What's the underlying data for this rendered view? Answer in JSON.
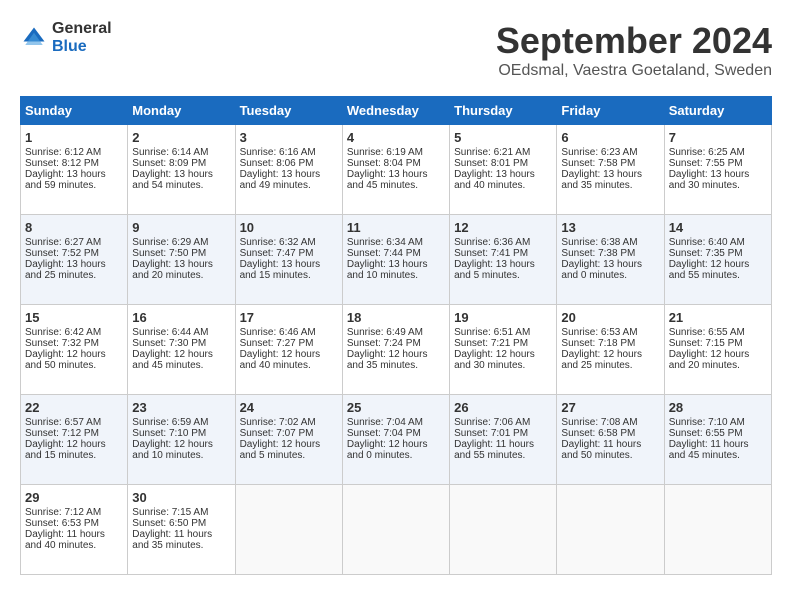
{
  "logo": {
    "general": "General",
    "blue": "Blue"
  },
  "title": "September 2024",
  "location": "OEdsmal, Vaestra Goetaland, Sweden",
  "headers": [
    "Sunday",
    "Monday",
    "Tuesday",
    "Wednesday",
    "Thursday",
    "Friday",
    "Saturday"
  ],
  "weeks": [
    [
      {
        "day": "1",
        "sunrise": "Sunrise: 6:12 AM",
        "sunset": "Sunset: 8:12 PM",
        "daylight": "Daylight: 13 hours and 59 minutes."
      },
      {
        "day": "2",
        "sunrise": "Sunrise: 6:14 AM",
        "sunset": "Sunset: 8:09 PM",
        "daylight": "Daylight: 13 hours and 54 minutes."
      },
      {
        "day": "3",
        "sunrise": "Sunrise: 6:16 AM",
        "sunset": "Sunset: 8:06 PM",
        "daylight": "Daylight: 13 hours and 49 minutes."
      },
      {
        "day": "4",
        "sunrise": "Sunrise: 6:19 AM",
        "sunset": "Sunset: 8:04 PM",
        "daylight": "Daylight: 13 hours and 45 minutes."
      },
      {
        "day": "5",
        "sunrise": "Sunrise: 6:21 AM",
        "sunset": "Sunset: 8:01 PM",
        "daylight": "Daylight: 13 hours and 40 minutes."
      },
      {
        "day": "6",
        "sunrise": "Sunrise: 6:23 AM",
        "sunset": "Sunset: 7:58 PM",
        "daylight": "Daylight: 13 hours and 35 minutes."
      },
      {
        "day": "7",
        "sunrise": "Sunrise: 6:25 AM",
        "sunset": "Sunset: 7:55 PM",
        "daylight": "Daylight: 13 hours and 30 minutes."
      }
    ],
    [
      {
        "day": "8",
        "sunrise": "Sunrise: 6:27 AM",
        "sunset": "Sunset: 7:52 PM",
        "daylight": "Daylight: 13 hours and 25 minutes."
      },
      {
        "day": "9",
        "sunrise": "Sunrise: 6:29 AM",
        "sunset": "Sunset: 7:50 PM",
        "daylight": "Daylight: 13 hours and 20 minutes."
      },
      {
        "day": "10",
        "sunrise": "Sunrise: 6:32 AM",
        "sunset": "Sunset: 7:47 PM",
        "daylight": "Daylight: 13 hours and 15 minutes."
      },
      {
        "day": "11",
        "sunrise": "Sunrise: 6:34 AM",
        "sunset": "Sunset: 7:44 PM",
        "daylight": "Daylight: 13 hours and 10 minutes."
      },
      {
        "day": "12",
        "sunrise": "Sunrise: 6:36 AM",
        "sunset": "Sunset: 7:41 PM",
        "daylight": "Daylight: 13 hours and 5 minutes."
      },
      {
        "day": "13",
        "sunrise": "Sunrise: 6:38 AM",
        "sunset": "Sunset: 7:38 PM",
        "daylight": "Daylight: 13 hours and 0 minutes."
      },
      {
        "day": "14",
        "sunrise": "Sunrise: 6:40 AM",
        "sunset": "Sunset: 7:35 PM",
        "daylight": "Daylight: 12 hours and 55 minutes."
      }
    ],
    [
      {
        "day": "15",
        "sunrise": "Sunrise: 6:42 AM",
        "sunset": "Sunset: 7:32 PM",
        "daylight": "Daylight: 12 hours and 50 minutes."
      },
      {
        "day": "16",
        "sunrise": "Sunrise: 6:44 AM",
        "sunset": "Sunset: 7:30 PM",
        "daylight": "Daylight: 12 hours and 45 minutes."
      },
      {
        "day": "17",
        "sunrise": "Sunrise: 6:46 AM",
        "sunset": "Sunset: 7:27 PM",
        "daylight": "Daylight: 12 hours and 40 minutes."
      },
      {
        "day": "18",
        "sunrise": "Sunrise: 6:49 AM",
        "sunset": "Sunset: 7:24 PM",
        "daylight": "Daylight: 12 hours and 35 minutes."
      },
      {
        "day": "19",
        "sunrise": "Sunrise: 6:51 AM",
        "sunset": "Sunset: 7:21 PM",
        "daylight": "Daylight: 12 hours and 30 minutes."
      },
      {
        "day": "20",
        "sunrise": "Sunrise: 6:53 AM",
        "sunset": "Sunset: 7:18 PM",
        "daylight": "Daylight: 12 hours and 25 minutes."
      },
      {
        "day": "21",
        "sunrise": "Sunrise: 6:55 AM",
        "sunset": "Sunset: 7:15 PM",
        "daylight": "Daylight: 12 hours and 20 minutes."
      }
    ],
    [
      {
        "day": "22",
        "sunrise": "Sunrise: 6:57 AM",
        "sunset": "Sunset: 7:12 PM",
        "daylight": "Daylight: 12 hours and 15 minutes."
      },
      {
        "day": "23",
        "sunrise": "Sunrise: 6:59 AM",
        "sunset": "Sunset: 7:10 PM",
        "daylight": "Daylight: 12 hours and 10 minutes."
      },
      {
        "day": "24",
        "sunrise": "Sunrise: 7:02 AM",
        "sunset": "Sunset: 7:07 PM",
        "daylight": "Daylight: 12 hours and 5 minutes."
      },
      {
        "day": "25",
        "sunrise": "Sunrise: 7:04 AM",
        "sunset": "Sunset: 7:04 PM",
        "daylight": "Daylight: 12 hours and 0 minutes."
      },
      {
        "day": "26",
        "sunrise": "Sunrise: 7:06 AM",
        "sunset": "Sunset: 7:01 PM",
        "daylight": "Daylight: 11 hours and 55 minutes."
      },
      {
        "day": "27",
        "sunrise": "Sunrise: 7:08 AM",
        "sunset": "Sunset: 6:58 PM",
        "daylight": "Daylight: 11 hours and 50 minutes."
      },
      {
        "day": "28",
        "sunrise": "Sunrise: 7:10 AM",
        "sunset": "Sunset: 6:55 PM",
        "daylight": "Daylight: 11 hours and 45 minutes."
      }
    ],
    [
      {
        "day": "29",
        "sunrise": "Sunrise: 7:12 AM",
        "sunset": "Sunset: 6:53 PM",
        "daylight": "Daylight: 11 hours and 40 minutes."
      },
      {
        "day": "30",
        "sunrise": "Sunrise: 7:15 AM",
        "sunset": "Sunset: 6:50 PM",
        "daylight": "Daylight: 11 hours and 35 minutes."
      },
      {
        "day": "",
        "sunrise": "",
        "sunset": "",
        "daylight": ""
      },
      {
        "day": "",
        "sunrise": "",
        "sunset": "",
        "daylight": ""
      },
      {
        "day": "",
        "sunrise": "",
        "sunset": "",
        "daylight": ""
      },
      {
        "day": "",
        "sunrise": "",
        "sunset": "",
        "daylight": ""
      },
      {
        "day": "",
        "sunrise": "",
        "sunset": "",
        "daylight": ""
      }
    ]
  ]
}
